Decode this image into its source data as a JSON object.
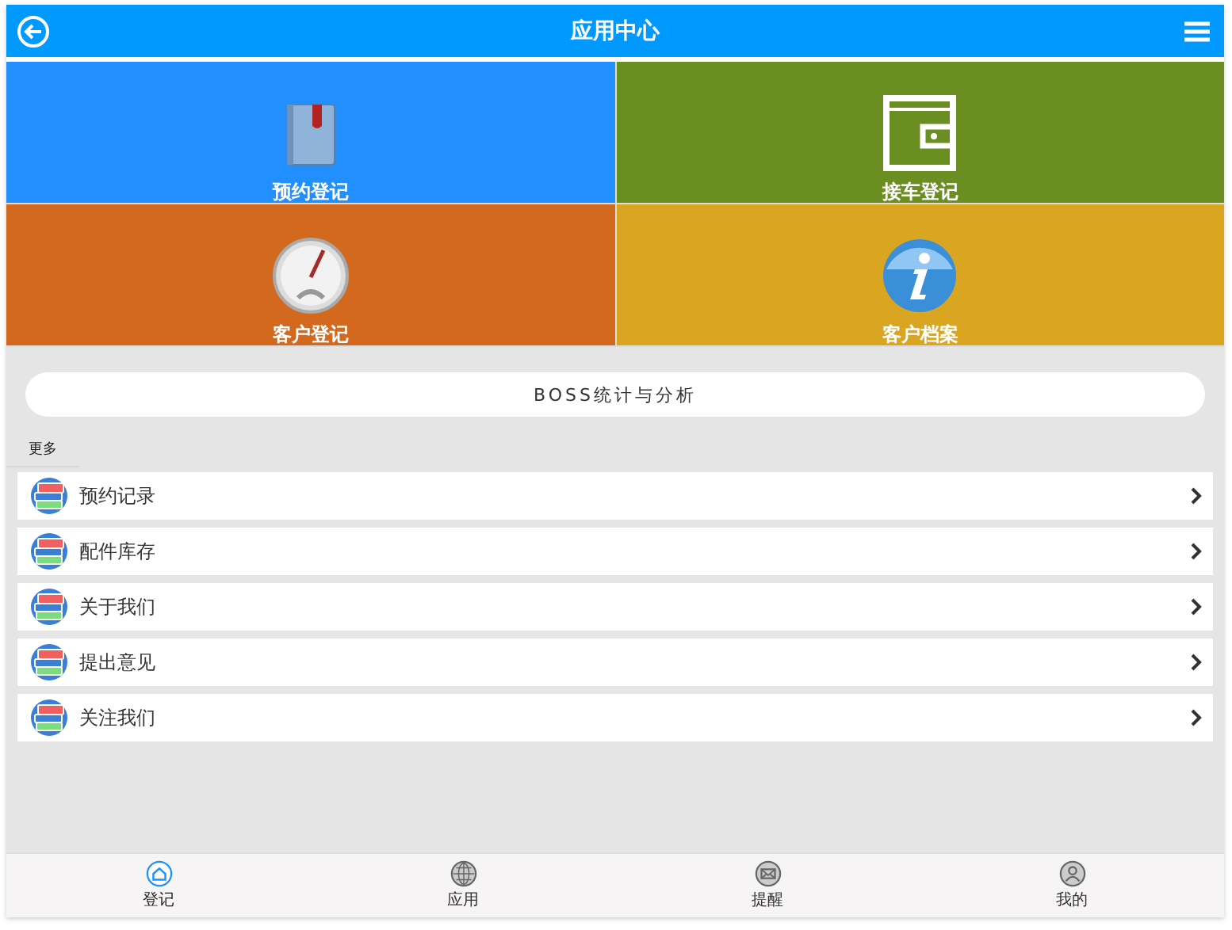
{
  "header": {
    "title": "应用中心"
  },
  "tiles": [
    {
      "label": "预约登记",
      "kind": "book",
      "color": "#218ffe"
    },
    {
      "label": "接车登记",
      "kind": "wallet",
      "color": "#6b8e23"
    },
    {
      "label": "客户登记",
      "kind": "gauge",
      "color": "#d2691e"
    },
    {
      "label": "客户档案",
      "kind": "info",
      "color": "#daa520"
    }
  ],
  "boss_button": "BOSS统计与分析",
  "section_title": "更多",
  "list_items": [
    "预约记录",
    "配件库存",
    "关于我们",
    "提出意见",
    "关注我们"
  ],
  "tab_bar": [
    {
      "label": "登记",
      "kind": "home",
      "selected": true
    },
    {
      "label": "应用",
      "kind": "globe",
      "selected": false
    },
    {
      "label": "提醒",
      "kind": "mail",
      "selected": false
    },
    {
      "label": "我的",
      "kind": "user",
      "selected": false
    }
  ]
}
